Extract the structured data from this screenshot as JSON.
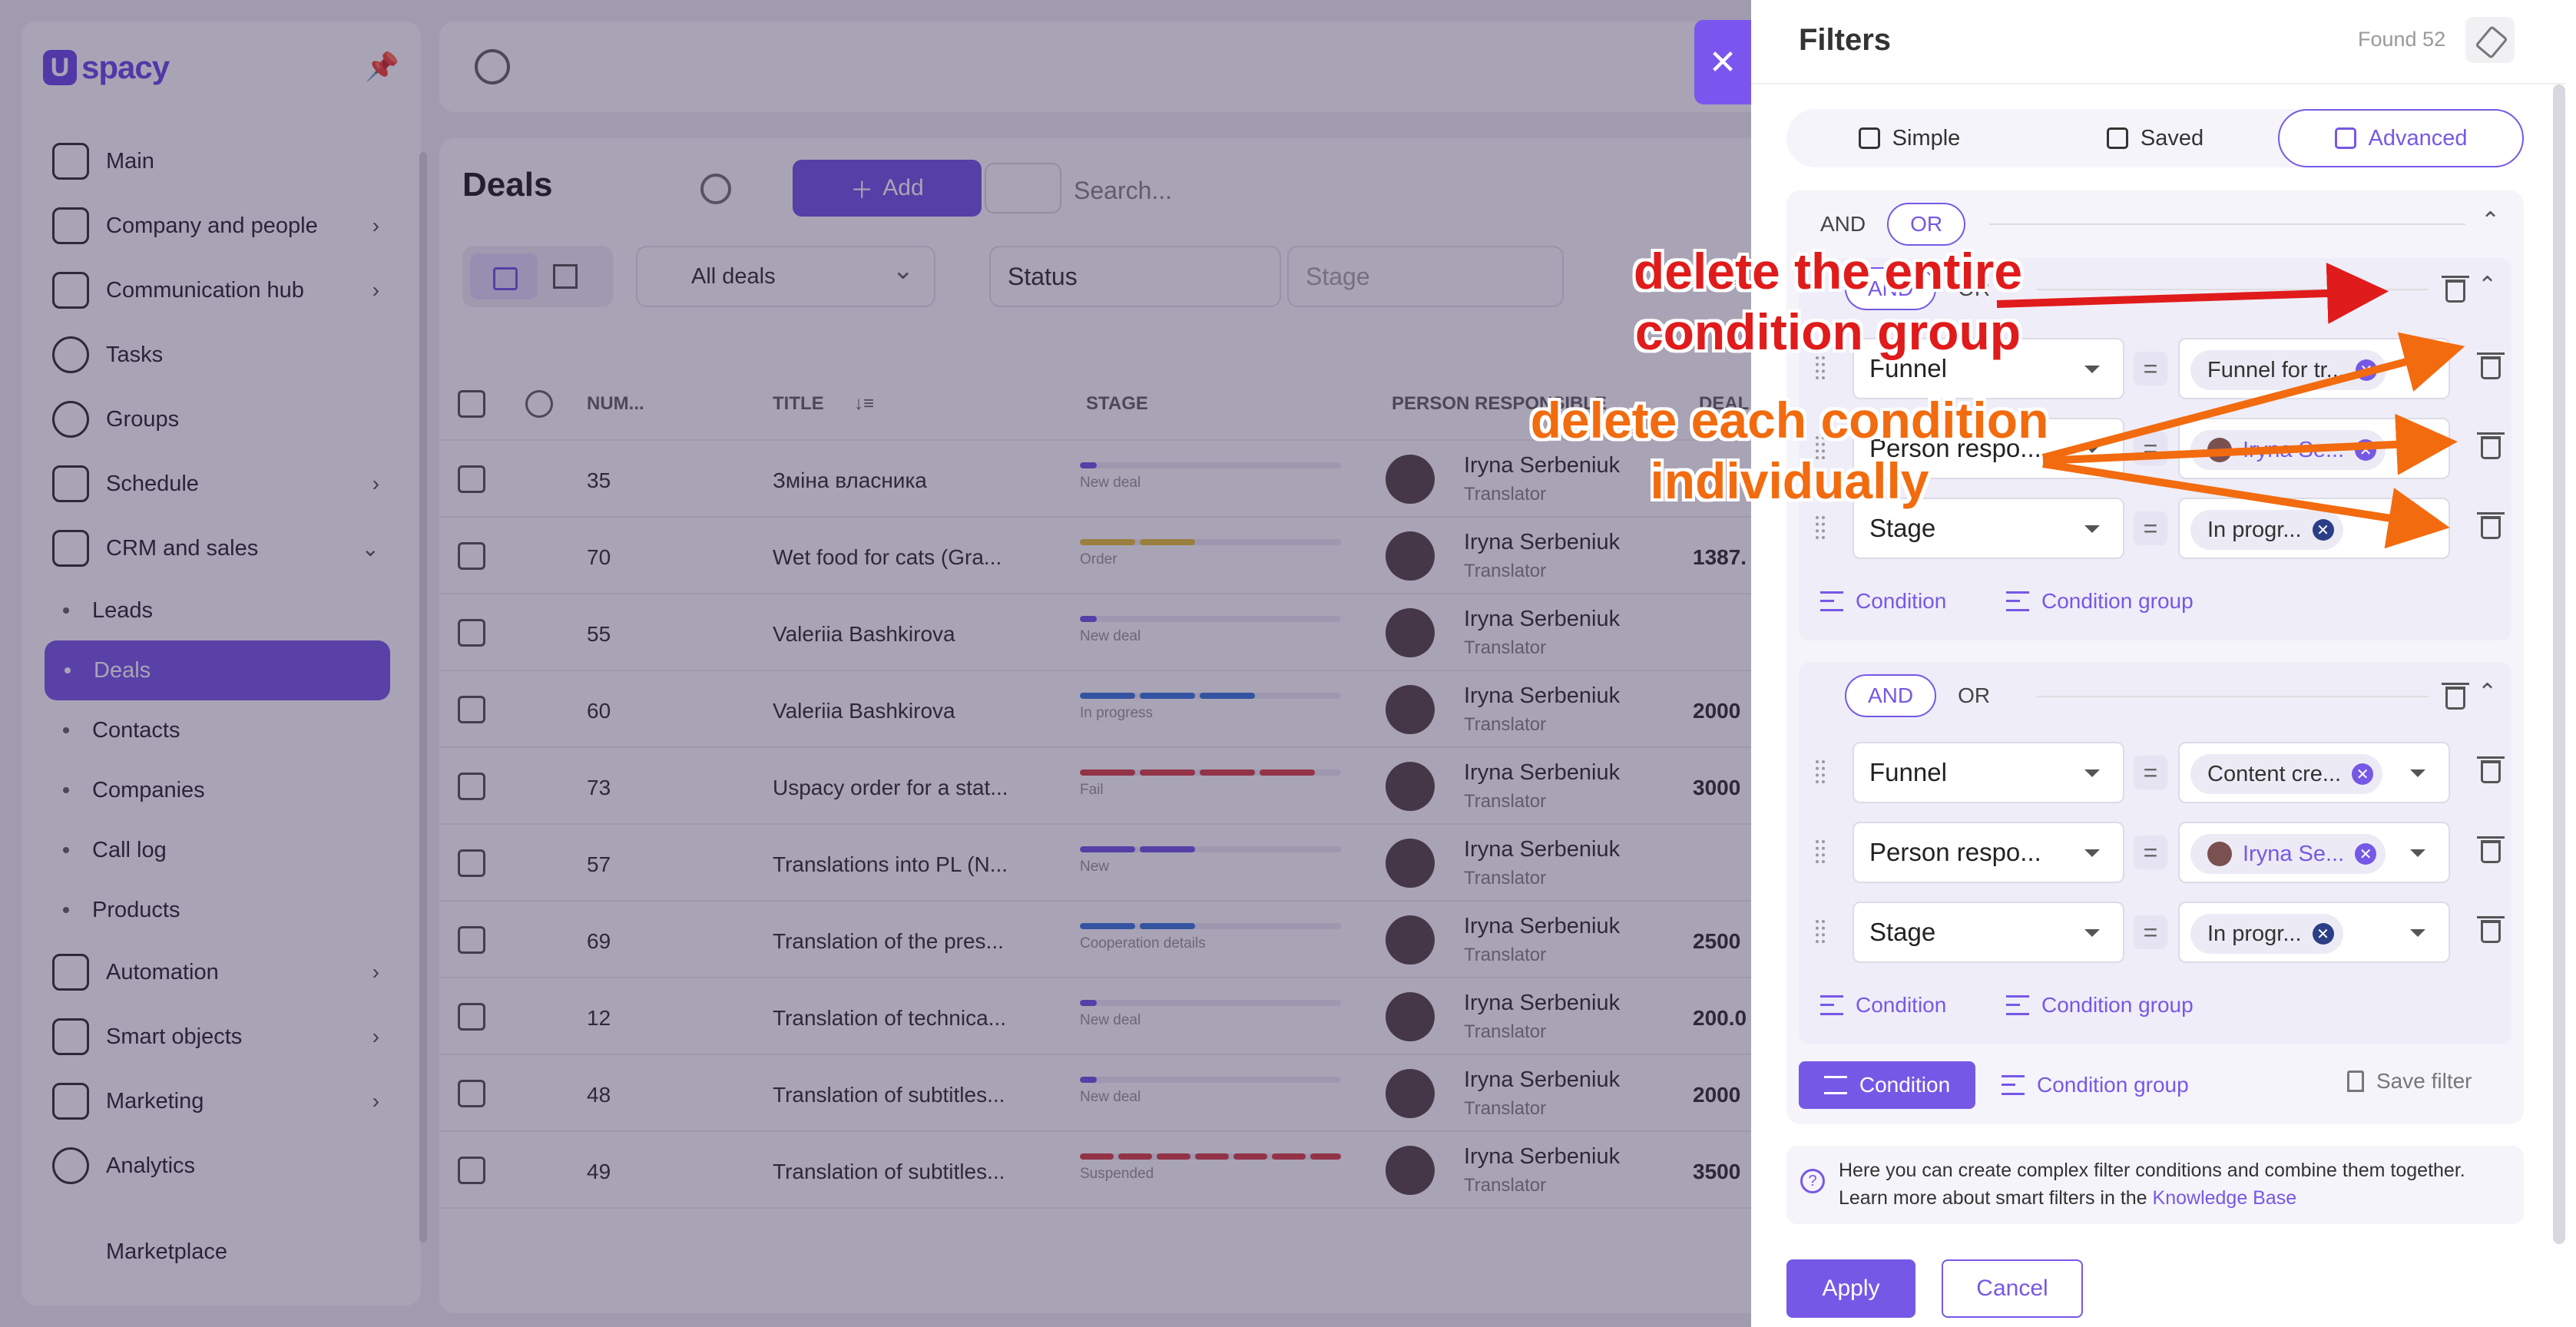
{
  "app": {
    "logo_letter": "U",
    "logo_text": "spacy"
  },
  "sidebar": {
    "items": [
      {
        "label": "Main",
        "has_chevron": false
      },
      {
        "label": "Company and people",
        "has_chevron": true
      },
      {
        "label": "Communication hub",
        "has_chevron": true
      },
      {
        "label": "Tasks",
        "has_chevron": false
      },
      {
        "label": "Groups",
        "has_chevron": false
      },
      {
        "label": "Schedule",
        "has_chevron": true
      },
      {
        "label": "CRM and sales",
        "has_chevron": true
      }
    ],
    "crm_sub": [
      "Leads",
      "Deals",
      "Contacts",
      "Companies",
      "Call log",
      "Products"
    ],
    "items_after": [
      {
        "label": "Automation"
      },
      {
        "label": "Smart objects"
      },
      {
        "label": "Marketing"
      },
      {
        "label": "Analytics"
      },
      {
        "label": "Marketplace"
      }
    ]
  },
  "main": {
    "title": "Deals",
    "add_label": "Add",
    "search_placeholder": "Search...",
    "all_deals": "All deals",
    "filter_status": "Status",
    "filter_stage": "Stage",
    "columns": {
      "num": "NUM...",
      "title": "TITLE",
      "stage": "STAGE",
      "person": "PERSON RESPONSIBLE",
      "amount": "DEAL"
    },
    "rows": [
      {
        "num": "35",
        "title": "Зміна власника",
        "stage": "New deal",
        "person": "Iryna Serbeniuk",
        "role": "Translator",
        "amount": ""
      },
      {
        "num": "70",
        "title": "Wet food for cats (Gra...",
        "stage": "Order",
        "person": "Iryna Serbeniuk",
        "role": "Translator",
        "amount": "1387."
      },
      {
        "num": "55",
        "title": "Valeriia Bashkirova",
        "stage": "New deal",
        "person": "Iryna Serbeniuk",
        "role": "Translator",
        "amount": ""
      },
      {
        "num": "60",
        "title": "Valeriia Bashkirova",
        "stage": "In progress",
        "person": "Iryna Serbeniuk",
        "role": "Translator",
        "amount": "2000"
      },
      {
        "num": "73",
        "title": "Uspacy order for a stat...",
        "stage": "Fail",
        "person": "Iryna Serbeniuk",
        "role": "Translator",
        "amount": "3000"
      },
      {
        "num": "57",
        "title": "Translations into PL (N...",
        "stage": "New",
        "person": "Iryna Serbeniuk",
        "role": "Translator",
        "amount": ""
      },
      {
        "num": "69",
        "title": "Translation of the pres...",
        "stage": "Cooperation details",
        "person": "Iryna Serbeniuk",
        "role": "Translator",
        "amount": "2500"
      },
      {
        "num": "12",
        "title": "Translation of technica...",
        "stage": "New deal",
        "person": "Iryna Serbeniuk",
        "role": "Translator",
        "amount": "200.0"
      },
      {
        "num": "48",
        "title": "Translation of subtitles...",
        "stage": "New deal",
        "person": "Iryna Serbeniuk",
        "role": "Translator",
        "amount": "2000"
      },
      {
        "num": "49",
        "title": "Translation of subtitles...",
        "stage": "Suspended",
        "person": "Iryna Serbeniuk",
        "role": "Translator",
        "amount": "3500"
      }
    ]
  },
  "filters": {
    "title": "Filters",
    "found": "Found 52",
    "tabs": [
      "Simple",
      "Saved",
      "Advanced"
    ],
    "logic_and": "AND",
    "logic_or": "OR",
    "group1": {
      "rows": [
        {
          "field": "Funnel",
          "value": "Funnel for tr..."
        },
        {
          "field": "Person respo...",
          "value": "Iryna Se..."
        },
        {
          "field": "Stage",
          "value": "In progr..."
        }
      ]
    },
    "group2": {
      "rows": [
        {
          "field": "Funnel",
          "value": "Content cre..."
        },
        {
          "field": "Person respo...",
          "value": "Iryna Se..."
        },
        {
          "field": "Stage",
          "value": "In progr..."
        }
      ]
    },
    "condition_label": "Condition",
    "condition_group_label": "Condition group",
    "save_filter_label": "Save filter",
    "info_line1": "Here you can create complex filter conditions and combine them together.",
    "info_line2": "Learn more about smart filters in the",
    "info_link": "Knowledge Base",
    "apply": "Apply",
    "cancel": "Cancel"
  },
  "annotations": {
    "group_delete_line1": "delete the entire",
    "group_delete_line2": "condition group",
    "cond_delete_line1": "delete each condition",
    "cond_delete_line2": "individually",
    "red": "#e01b1b",
    "orange": "#f26b0f"
  }
}
